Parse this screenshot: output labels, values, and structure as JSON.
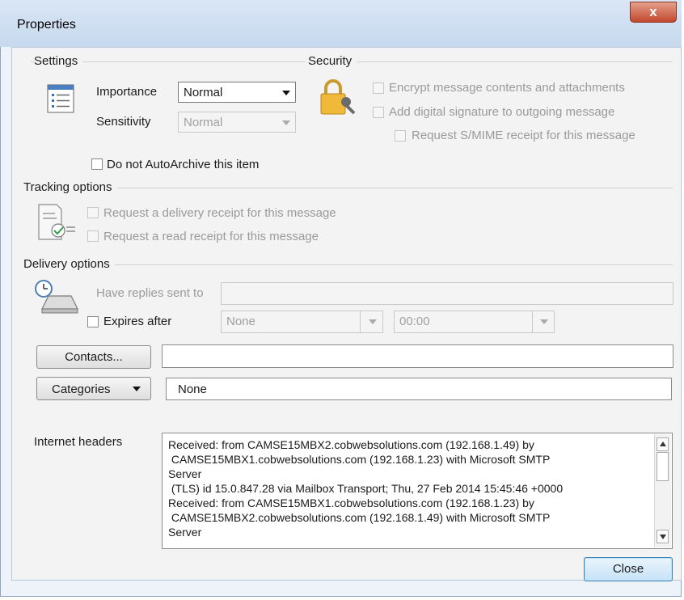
{
  "window": {
    "title": "Properties",
    "close_glyph": "x"
  },
  "settings": {
    "heading": "Settings",
    "importance_label": "Importance",
    "importance_value": "Normal",
    "sensitivity_label": "Sensitivity",
    "sensitivity_value": "Normal",
    "autoarchive_label": "Do not AutoArchive this item"
  },
  "security": {
    "heading": "Security",
    "encrypt_label": "Encrypt message contents and attachments",
    "signature_label": "Add digital signature to outgoing message",
    "smime_label": "Request S/MIME receipt for this message"
  },
  "tracking": {
    "heading": "Tracking options",
    "delivery_receipt_label": "Request a delivery receipt for this message",
    "read_receipt_label": "Request a read receipt for this message"
  },
  "delivery": {
    "heading": "Delivery options",
    "replies_label": "Have replies sent to",
    "replies_value": "",
    "expires_label": "Expires after",
    "expires_date": "None",
    "expires_time": "00:00"
  },
  "contacts": {
    "button_label": "Contacts...",
    "value": ""
  },
  "categories": {
    "button_label": "Categories",
    "value": "None"
  },
  "internet_headers": {
    "label": "Internet headers",
    "text": "Received: from CAMSE15MBX2.cobwebsolutions.com (192.168.1.49) by\n CAMSE15MBX1.cobwebsolutions.com (192.168.1.23) with Microsoft SMTP\nServer\n (TLS) id 15.0.847.28 via Mailbox Transport; Thu, 27 Feb 2014 15:45:46 +0000\nReceived: from CAMSE15MBX1.cobwebsolutions.com (192.168.1.23) by\n CAMSE15MBX2.cobwebsolutions.com (192.168.1.49) with Microsoft SMTP\nServer"
  },
  "footer": {
    "close_label": "Close"
  },
  "colors": {
    "close_button": "#c2472c",
    "window_bg": "#f3f3f3",
    "primary_button": "#c6e2f7"
  },
  "icons": [
    "settings-list-icon",
    "security-lock-key-icon",
    "tracking-checklist-icon",
    "delivery-clock-icon"
  ]
}
